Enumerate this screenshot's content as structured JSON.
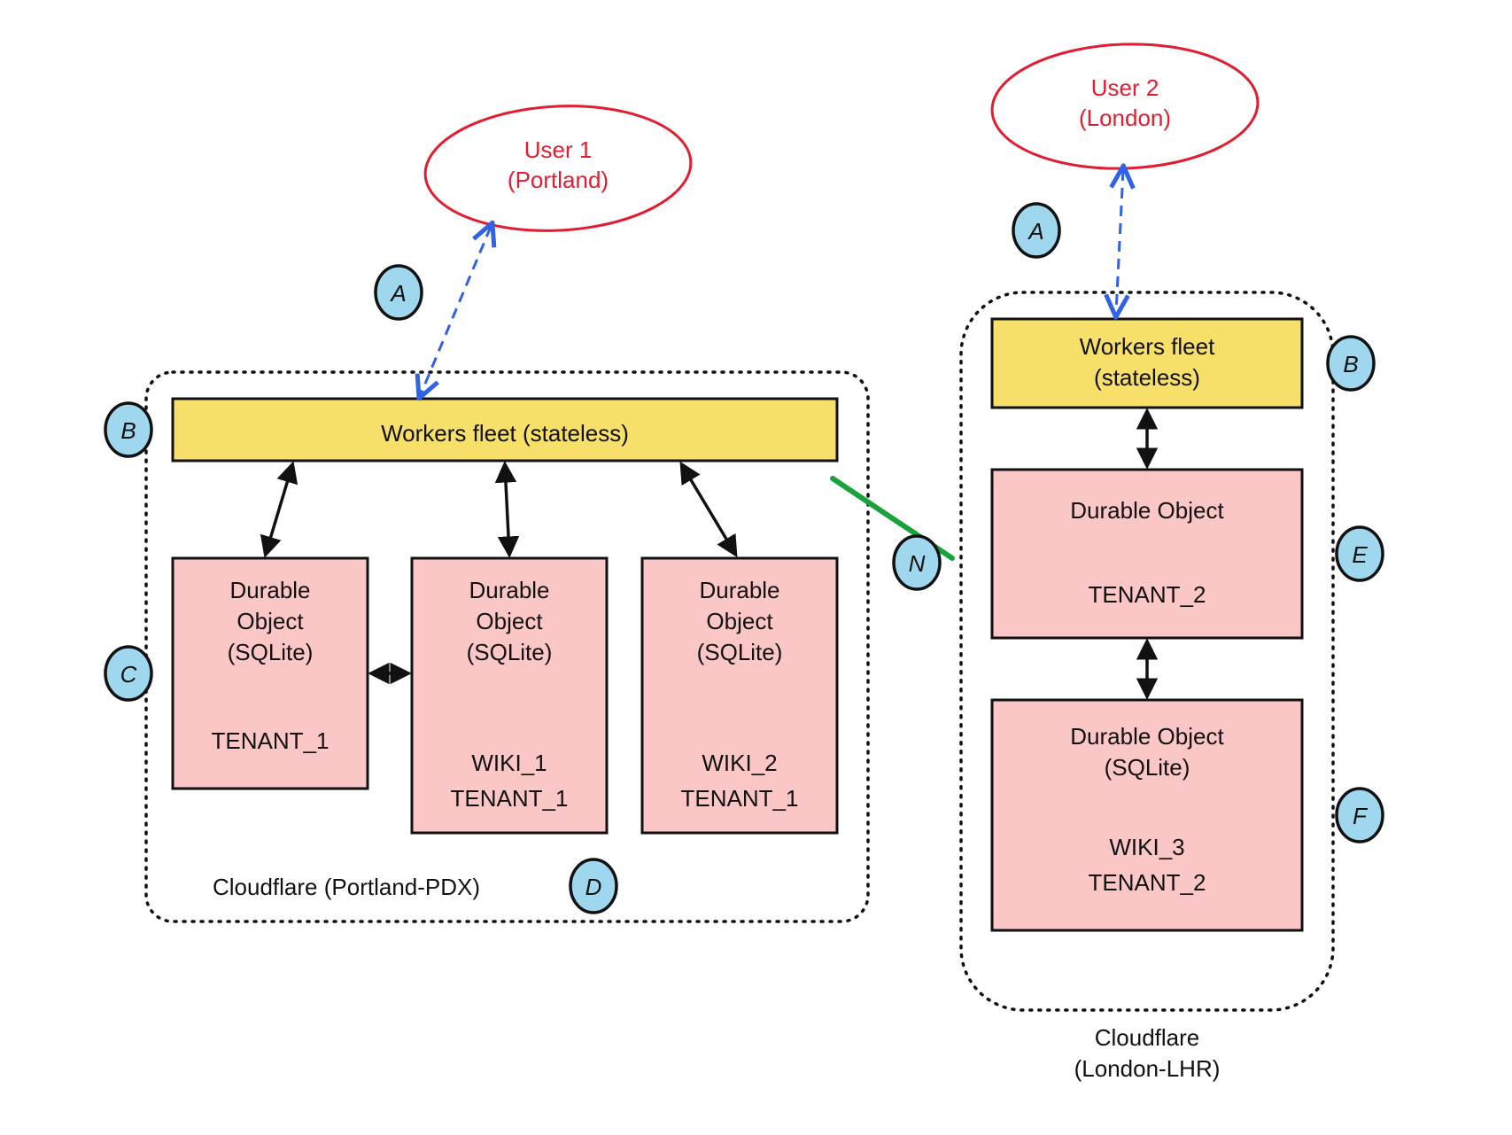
{
  "user1": {
    "line1": "User 1",
    "line2": "(Portland)"
  },
  "user2": {
    "line1": "User 2",
    "line2": "(London)"
  },
  "region_pdx": {
    "caption": "Cloudflare (Portland-PDX)"
  },
  "region_lhr": {
    "caption_line1": "Cloudflare",
    "caption_line2": "(London-LHR)"
  },
  "workers_pdx": "Workers fleet (stateless)",
  "workers_lhr_line1": "Workers fleet",
  "workers_lhr_line2": "(stateless)",
  "do_pdx_1": {
    "l1": "Durable",
    "l2": "Object",
    "l3": "(SQLite)",
    "l4": "TENANT_1"
  },
  "do_pdx_2": {
    "l1": "Durable",
    "l2": "Object",
    "l3": "(SQLite)",
    "l4": "WIKI_1",
    "l5": "TENANT_1"
  },
  "do_pdx_3": {
    "l1": "Durable",
    "l2": "Object",
    "l3": "(SQLite)",
    "l4": "WIKI_2",
    "l5": "TENANT_1"
  },
  "do_lhr_1": {
    "l1": "Durable Object",
    "l2": "TENANT_2"
  },
  "do_lhr_2": {
    "l1": "Durable Object",
    "l2": "(SQLite)",
    "l3": "WIKI_3",
    "l4": "TENANT_2"
  },
  "chips": {
    "A": "A",
    "B": "B",
    "C": "C",
    "D": "D",
    "E": "E",
    "F": "F",
    "N": "N"
  }
}
